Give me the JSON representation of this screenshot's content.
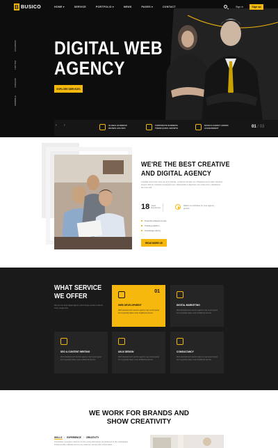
{
  "brand": {
    "logo_letter": "B",
    "name": "BUSICO"
  },
  "nav": {
    "items": [
      "HOME ▾",
      "SERVICE",
      "PORTFOLIO ▾",
      "NEWS",
      "PAGES ▾",
      "CONTACT"
    ],
    "signin": "Sign in",
    "signup": "Sign up"
  },
  "hero": {
    "title_line1": "DIGITAL WEB",
    "title_line2": "AGENCY",
    "button": "EXPLORE SERVICES",
    "social": [
      "FACEBOOK",
      "TWITTER",
      "LINKEDIN",
      "DRIBBBLE"
    ],
    "prev": "‹",
    "next": "›",
    "features": [
      {
        "icon": "award-icon",
        "text": "GLOBAL BUSINESS REVIEW JAN 2020"
      },
      {
        "icon": "chart-icon",
        "text": "CORPORATE BUSINESS TREND QUICK GROWTH"
      },
      {
        "icon": "trophy-icon",
        "text": "BUSICO AGENCY AWARD ACHIEVEMENT"
      }
    ],
    "pager_current": "01",
    "pager_total": "/ 03"
  },
  "about": {
    "title_line1": "WE'RE THE BEST CREATIVE",
    "title_line2": "AND DIGITAL AGENCY",
    "text": "Curabitur ante lorem duis nec id ut lobortis, ut lobortis elit felis non. Phasellus lorem dolor, faucibus tempor nibh eu, tincidunt consequat nunc. Nulla facilisi ut dignissim sem vitae lorem. Vestibulum dui urna velit.",
    "years_num": "18",
    "years_label": "Years Experience",
    "video_text": "Watch our activities for your agency growth",
    "list": [
      "Powerful software & tools",
      "Tracking platform",
      "Knowledge Library"
    ],
    "button": "READ MORE US"
  },
  "services": {
    "title_line1": "WHAT SERVICE",
    "title_line2": "WE OFFER",
    "text": "We are the best digital agency who brings results to clients every single time.",
    "cards": [
      {
        "icon": "web-icon",
        "title": "WEB DEVELOPMENT",
        "text": "Web development service agency may sound good but it typically takes more traditional service.",
        "num": "01"
      },
      {
        "icon": "marketing-icon",
        "title": "DIGITAL MARKETING",
        "text": "Web development service agency may sound good but it typically takes more traditional service.",
        "num": ""
      },
      {
        "icon": "seo-icon",
        "title": "SEO & CONTENT WRITING",
        "text": "Web development service agency may sound good but it typically takes more traditional service.",
        "num": ""
      },
      {
        "icon": "design-icon",
        "title": "UI/UX DESIGN",
        "text": "Web development service agency may sound good but it typically takes more traditional service.",
        "num": ""
      },
      {
        "icon": "consult-icon",
        "title": "CONSULTANCY",
        "text": "Web development service agency may sound good but it typically takes more traditional service.",
        "num": ""
      }
    ]
  },
  "brands": {
    "title_line1": "WE WORK FOR BRANDS AND",
    "title_line2": "SHOW CREATIVITY",
    "tabs": [
      "SKILLS",
      "EXPERIENCE",
      "CREATIVITY"
    ],
    "sep": "/",
    "text": "Completely synergize resource for the young technology we produced to the marketplace. Professionally cultivate one-to-one customer service with robust ideas."
  },
  "colors": {
    "accent": "#f6b80c",
    "dark": "#0d0d0d"
  }
}
